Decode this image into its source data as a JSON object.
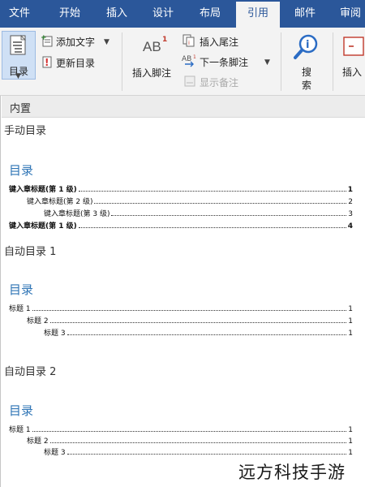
{
  "tabs": [
    "文件",
    "开始",
    "插入",
    "设计",
    "布局",
    "引用",
    "邮件",
    "审阅"
  ],
  "active_tab": "引用",
  "ribbon": {
    "toc_button": "目录",
    "add_text": "添加文字",
    "update_toc": "更新目录",
    "insert_footnote": "插入脚注",
    "insert_endnote": "插入尾注",
    "next_footnote": "下一条脚注",
    "show_notes": "显示备注",
    "search_1": "搜",
    "search_2": "索",
    "insert_partial": "插入",
    "ab_glyph": "AB",
    "ab_sup": "1"
  },
  "panel": {
    "header": "内置",
    "sections": [
      {
        "title": "手动目录",
        "heading": "目录",
        "entries": [
          {
            "text": "键入章标题(第 1 级)",
            "page": "1",
            "level": 1,
            "bold": true
          },
          {
            "text": "键入章标题(第 2 级)",
            "page": "2",
            "level": 2,
            "bold": false
          },
          {
            "text": "键入章标题(第 3 级)",
            "page": "3",
            "level": 3,
            "bold": false
          },
          {
            "text": "键入章标题(第 1 级)",
            "page": "4",
            "level": 1,
            "bold": true
          }
        ]
      },
      {
        "title": "自动目录 1",
        "heading": "目录",
        "entries": [
          {
            "text": "标题 1",
            "page": "1",
            "level": 1,
            "bold": false
          },
          {
            "text": "标题 2",
            "page": "1",
            "level": 2,
            "bold": false
          },
          {
            "text": "标题 3",
            "page": "1",
            "level": 3,
            "bold": false
          }
        ]
      },
      {
        "title": "自动目录 2",
        "heading": "目录",
        "entries": [
          {
            "text": "标题 1",
            "page": "1",
            "level": 1,
            "bold": false
          },
          {
            "text": "标题 2",
            "page": "1",
            "level": 2,
            "bold": false
          },
          {
            "text": "标题 3",
            "page": "1",
            "level": 3,
            "bold": false
          }
        ]
      }
    ]
  },
  "watermark": "远方科技手游",
  "colors": {
    "brand": "#2b579a",
    "heading": "#2e74b5",
    "ribbon_bg": "#f3f3f3"
  }
}
